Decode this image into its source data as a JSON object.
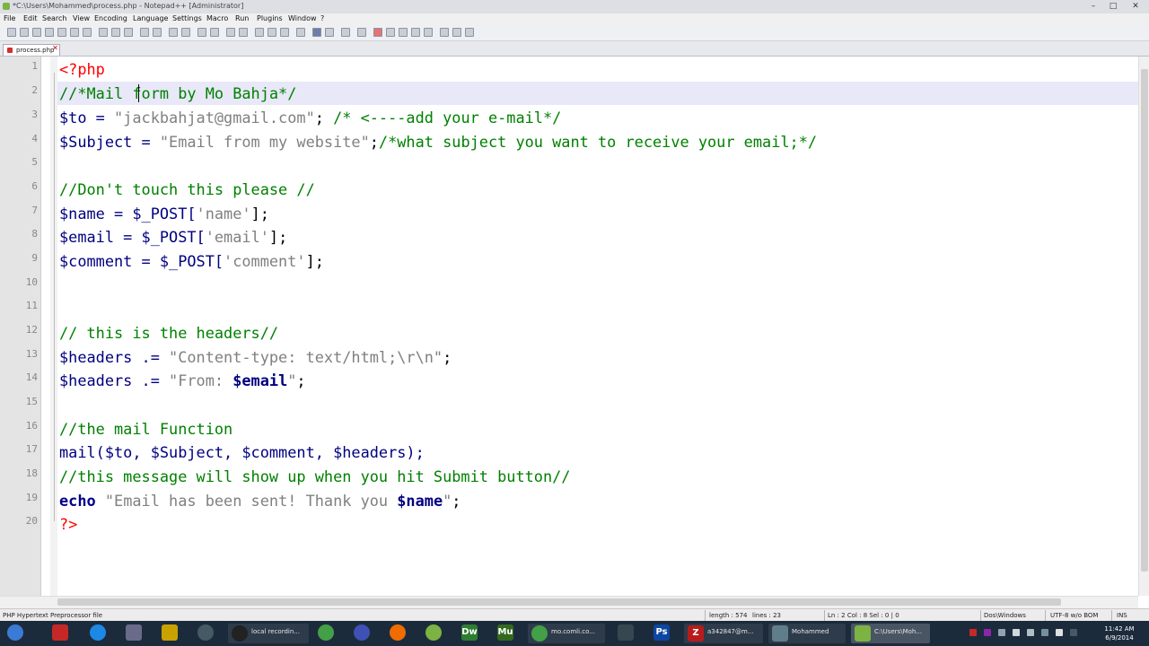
{
  "window": {
    "title": "*C:\\Users\\Mohammed\\process.php - Notepad++ [Administrator]",
    "controls": {
      "minimize": "–",
      "maximize": "□",
      "close": "✕"
    }
  },
  "menu": [
    "File",
    "Edit",
    "Search",
    "View",
    "Encoding",
    "Language",
    "Settings",
    "Macro",
    "Run",
    "Plugins",
    "Window",
    "?"
  ],
  "tabs": [
    {
      "label": "process.php",
      "close": "✕"
    }
  ],
  "editor": {
    "line_numbers": [
      "1",
      "2",
      "3",
      "4",
      "5",
      "6",
      "7",
      "8",
      "9",
      "10",
      "11",
      "12",
      "13",
      "14",
      "15",
      "16",
      "17",
      "18",
      "19",
      "20"
    ],
    "lines": {
      "l1": "<?php",
      "l2": "//*Mail form by Mo Bahja*/",
      "l3_a": "$to = ",
      "l3_b": "\"jackbahjat@gmail.com\"",
      "l3_c": "; ",
      "l3_d": "/* <----add your e-mail*/",
      "l4_a": "$Subject = ",
      "l4_b": "\"Email from my website\"",
      "l4_c": ";",
      "l4_d": "/*what subject you want to receive your email;*/",
      "l6": "//Don't touch this please //",
      "l7_a": "$name = $_POST[",
      "l7_b": "'name'",
      "l7_c": "];",
      "l8_a": "$email = $_POST[",
      "l8_b": "'email'",
      "l8_c": "];",
      "l9_a": "$comment = $_POST[",
      "l9_b": "'comment'",
      "l9_c": "];",
      "l12": "// this is the headers//",
      "l13_a": "$headers .= ",
      "l13_b": "\"Content-type: text/html;\\r\\n\"",
      "l13_c": ";",
      "l14_a": "$headers .= ",
      "l14_b": "\"From: ",
      "l14_v": "$email",
      "l14_e": "\"",
      "l14_c": ";",
      "l16": "//the mail Function",
      "l17": "mail($to, $Subject, $comment, $headers);",
      "l18": "//this message will show up when you hit Submit button//",
      "l19_k": "echo",
      "l19_b": " \"Email has been sent! Thank you ",
      "l19_v": "$name",
      "l19_e": "\"",
      "l19_c": ";",
      "l20": "?>"
    }
  },
  "statusbar": {
    "language": "PHP Hypertext Preprocessor file",
    "length": "length : 574",
    "lines": "lines : 23",
    "position": "Ln : 2   Col : 8   Sel : 0 | 0",
    "eol": "Dos\\Windows",
    "encoding": "UTF-8 w/o BOM",
    "mode": "INS"
  },
  "taskbar": {
    "items": [
      {
        "label": "local recordin..."
      },
      {
        "label": "mo.comli.co..."
      },
      {
        "label": "a342847@m..."
      },
      {
        "label": "Mohammed"
      },
      {
        "label": "C:\\Users\\Moh..."
      }
    ],
    "icons": {
      "ps": "Ps",
      "dw": "Dw",
      "mu": "Mu",
      "fz": "Z"
    },
    "clock": {
      "time": "11:42 AM",
      "date": "6/9/2014"
    }
  },
  "colors": {
    "comment": "#008000",
    "string": "#808080",
    "keyword": "#00008b",
    "php_tag": "#ff0000",
    "current_line": "#e8e8f8"
  },
  "icons": [
    "notepadpp-icon",
    "new-file-icon",
    "open-icon",
    "save-icon",
    "find-icon",
    "zoom-icon",
    "macro-record-icon",
    "windows-start-icon",
    "chrome-icon",
    "firefox-icon",
    "photoshop-icon",
    "dreamweaver-icon",
    "filezilla-icon"
  ]
}
